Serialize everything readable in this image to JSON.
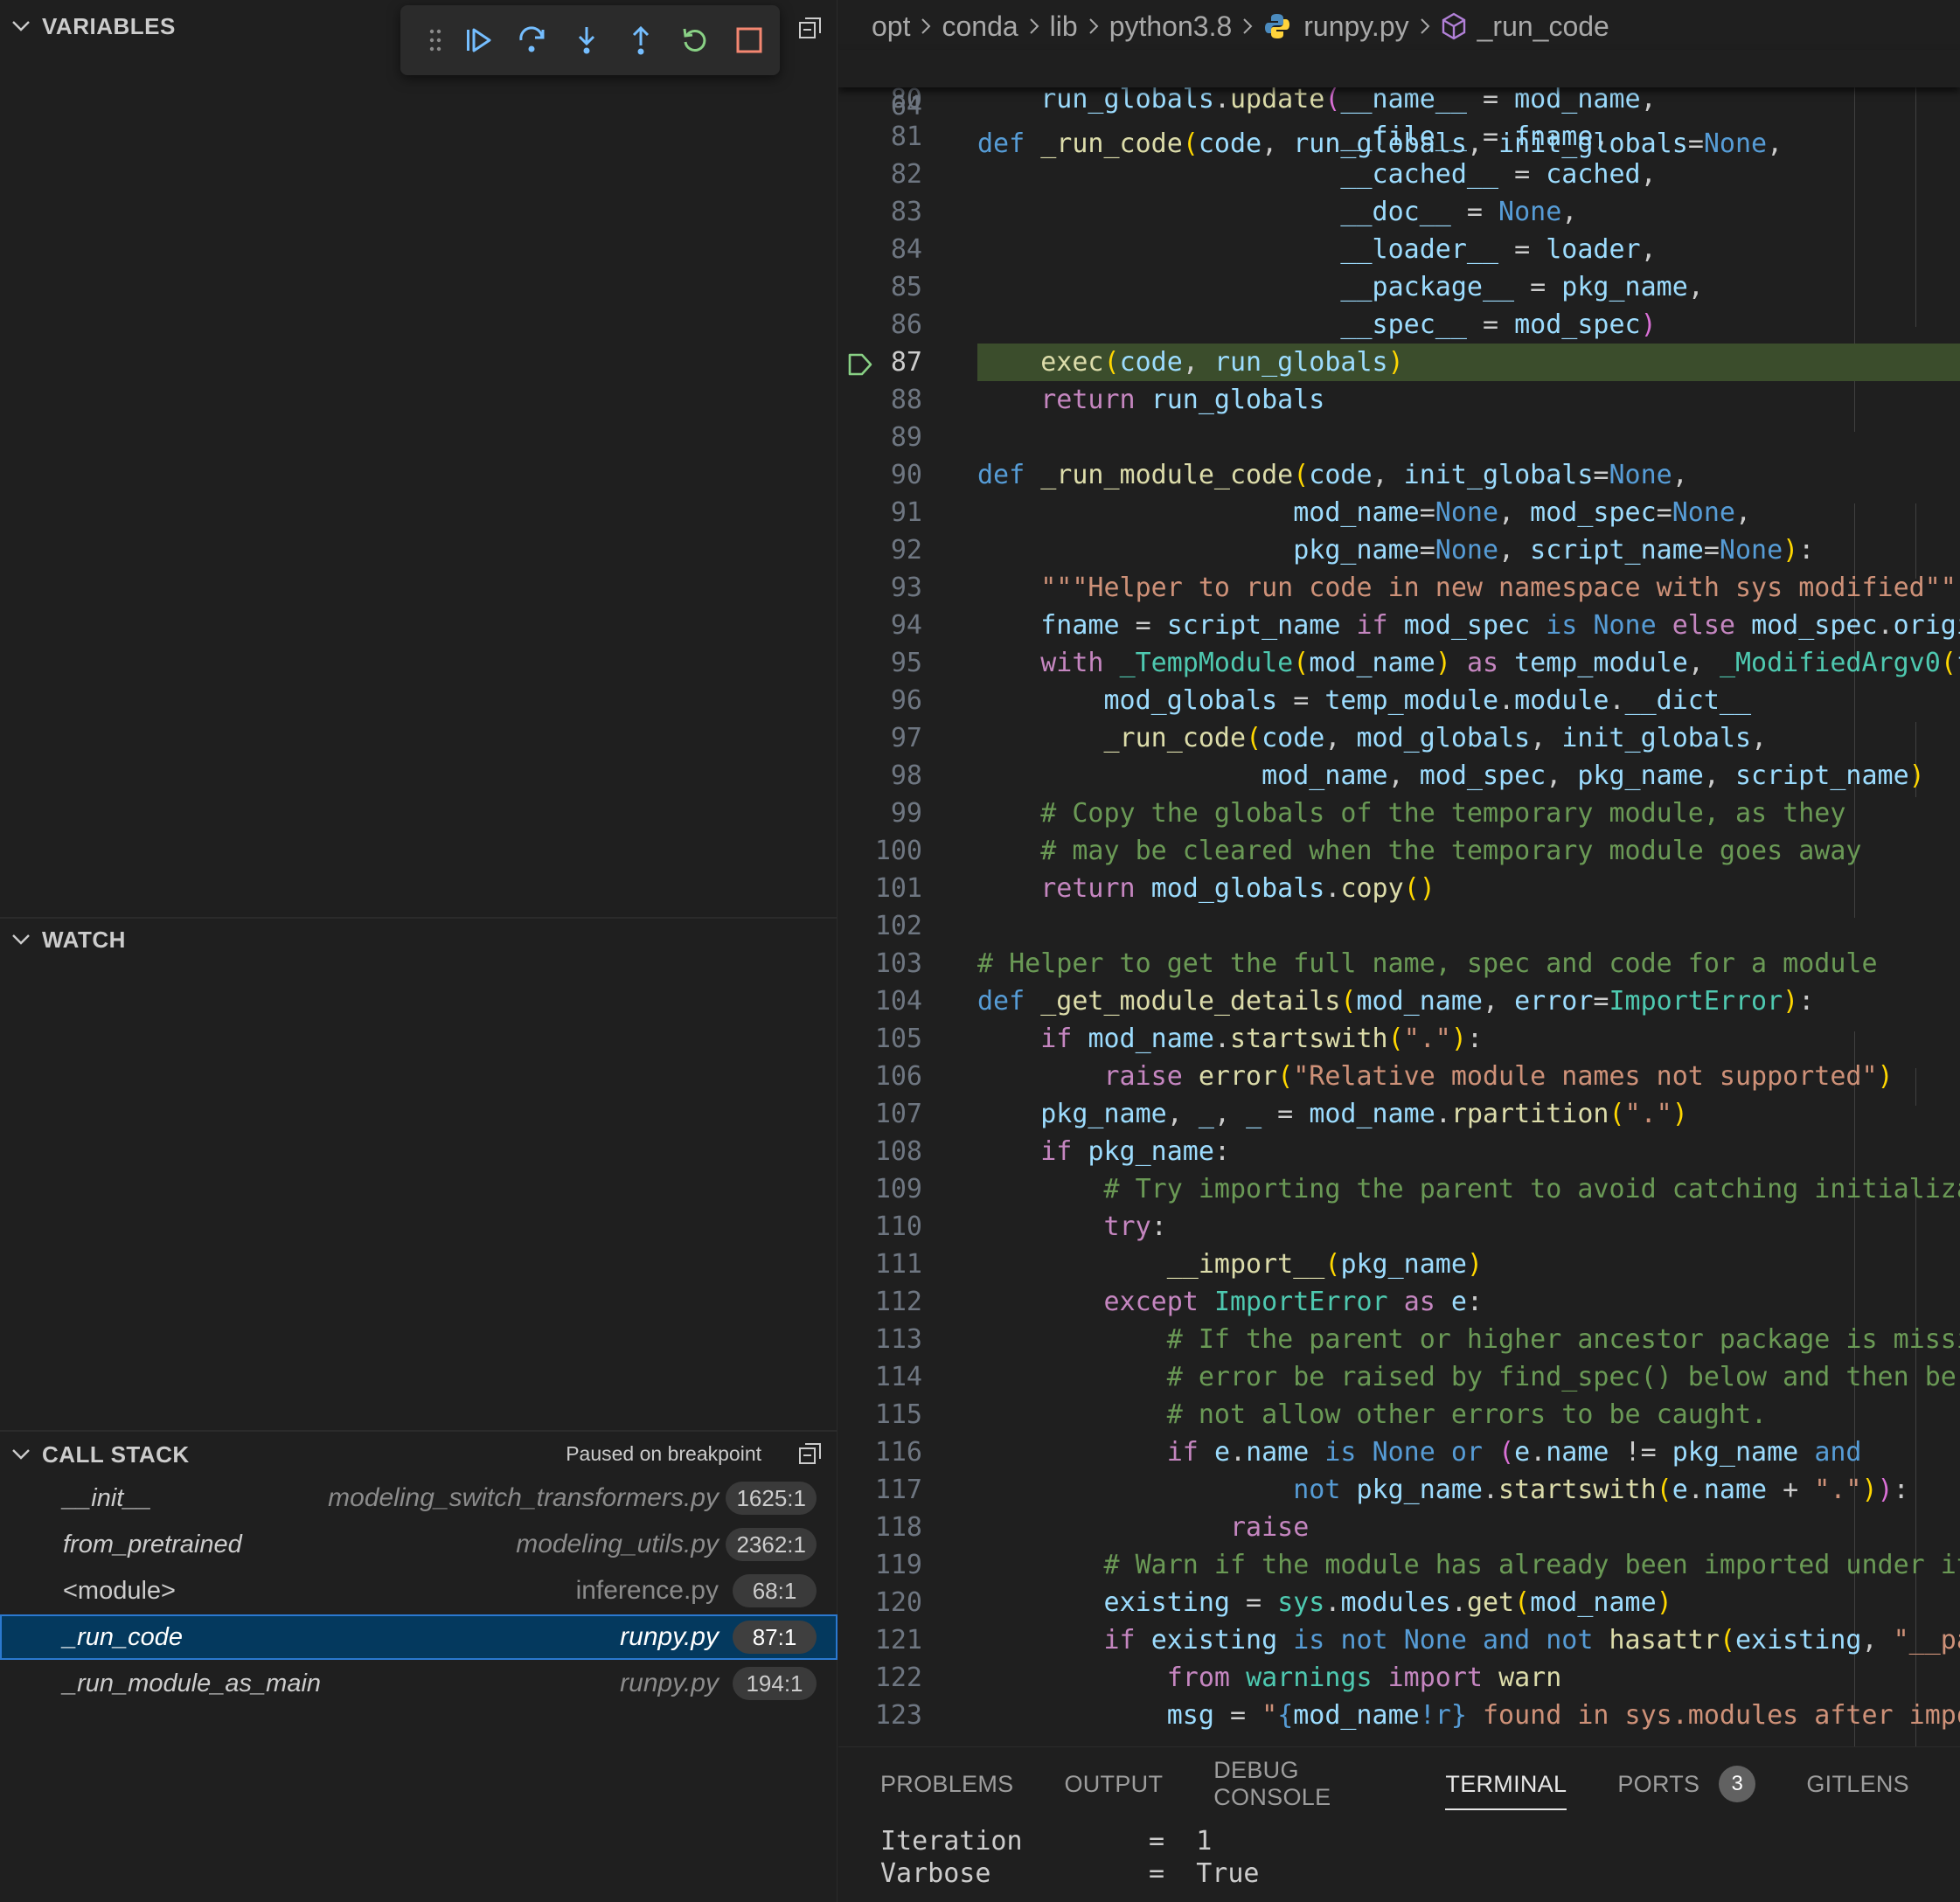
{
  "sidebar": {
    "variables_title": "VARIABLES",
    "watch_title": "WATCH",
    "callstack_title": "CALL STACK",
    "callstack_status": "Paused on breakpoint",
    "frames": [
      {
        "fn": "__init__",
        "file": "modeling_switch_transformers.py",
        "pos": "1625:1"
      },
      {
        "fn": "from_pretrained",
        "file": "modeling_utils.py",
        "pos": "2362:1"
      },
      {
        "fn": "<module>",
        "file": "inference.py",
        "pos": "68:1"
      },
      {
        "fn": "_run_code",
        "file": "runpy.py",
        "pos": "87:1"
      },
      {
        "fn": "_run_module_as_main",
        "file": "runpy.py",
        "pos": "194:1"
      }
    ]
  },
  "toolbar": {
    "buttons": [
      "continue-icon",
      "step-over-icon",
      "step-into-icon",
      "step-out-icon",
      "restart-icon",
      "stop-icon"
    ]
  },
  "breadcrumb": [
    "opt",
    "conda",
    "lib",
    "python3.8",
    "runpy.py",
    "_run_code"
  ],
  "editor": {
    "sticky_line_number": "64",
    "current_line": "87",
    "line_numbers": [
      "80",
      "81",
      "82",
      "83",
      "84",
      "85",
      "86",
      "87",
      "88",
      "89",
      "90",
      "91",
      "92",
      "93",
      "94",
      "95",
      "96",
      "97",
      "98",
      "99",
      "100",
      "101",
      "102",
      "103",
      "104",
      "105",
      "106",
      "107",
      "108",
      "109",
      "110",
      "111",
      "112",
      "113",
      "114",
      "115",
      "116",
      "117",
      "118",
      "119",
      "120",
      "121",
      "122",
      "123"
    ]
  },
  "panel": {
    "tabs": [
      "PROBLEMS",
      "OUTPUT",
      "DEBUG CONSOLE",
      "TERMINAL",
      "PORTS",
      "GITLENS"
    ],
    "active_tab": "TERMINAL",
    "ports_badge": "3",
    "terminal_lines": [
      "Iteration        =  1",
      "Varbose          =  True"
    ]
  },
  "colors": {
    "accent": "#2b79d0",
    "selection": "#04395e",
    "current_line": "#3b4d2c",
    "breakpoint_marker": "#89d185"
  }
}
